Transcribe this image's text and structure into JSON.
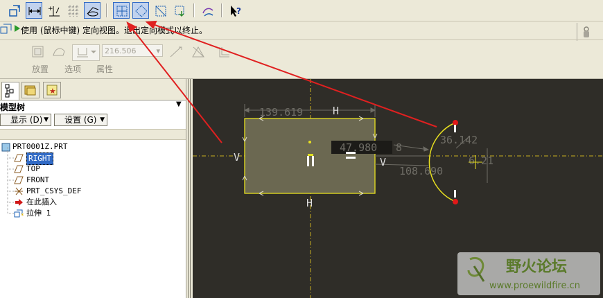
{
  "prompt": "使用 (鼠标中键) 定向视图。退出定向模式以终止。",
  "dashboard": {
    "depth_value": "216.506",
    "tabs": [
      "放置",
      "选项",
      "属性"
    ]
  },
  "model_tree": {
    "title": "模型树",
    "show_button": "显示 (D)",
    "settings_button": "设置 (G)",
    "items": [
      {
        "label": "PRT0001Z.PRT",
        "icon": "part-icon",
        "selected": false
      },
      {
        "label": "RIGHT",
        "icon": "datum-plane-icon",
        "selected": true
      },
      {
        "label": "TOP",
        "icon": "datum-plane-icon",
        "selected": false
      },
      {
        "label": "FRONT",
        "icon": "datum-plane-icon",
        "selected": false
      },
      {
        "label": "PRT_CSYS_DEF",
        "icon": "csys-icon",
        "selected": false
      },
      {
        "label": "在此插入",
        "icon": "insert-here-icon",
        "selected": false
      },
      {
        "label": "拉伸 1",
        "icon": "extrude-icon",
        "selected": false
      }
    ]
  },
  "sketch": {
    "dim_width": "139.619",
    "dim_offset": "47.980",
    "dim_offset_suffix": "8",
    "dim_radius": "36.142",
    "dim_length": "108.690",
    "dim_small": "6.21",
    "label_h": "H",
    "label_v": "V"
  },
  "watermark": {
    "title": "野火论坛",
    "url": "www.proewildfire.cn"
  },
  "colors": {
    "canvas_bg": "#2f2d28",
    "sketch_line": "#e8e020",
    "rectangle_fill": "#6b6851",
    "arrow_red": "#e02020",
    "selection_blue": "#316ac5"
  }
}
